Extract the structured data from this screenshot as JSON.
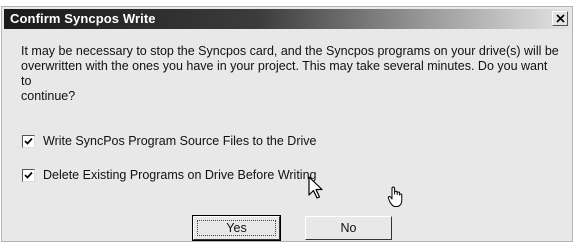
{
  "dialog": {
    "title": "Confirm Syncpos Write",
    "message": "It may be necessary to stop the Syncpos card, and the Syncpos programs on your drive(s) will be\noverwritten with the ones you have in your project.  This may take several minutes.  Do you want to\ncontinue?",
    "checkboxes": [
      {
        "label": "Write SyncPos Program Source Files to the Drive",
        "checked": true
      },
      {
        "label": "Delete Existing Programs on Drive Before Writing",
        "checked": true
      }
    ],
    "buttons": {
      "yes": "Yes",
      "no": "No"
    }
  },
  "icons": {
    "close": "close-icon",
    "check": "checkmark-icon",
    "arrow_cursor": "arrow-cursor-icon",
    "hand_cursor": "hand-cursor-icon"
  }
}
